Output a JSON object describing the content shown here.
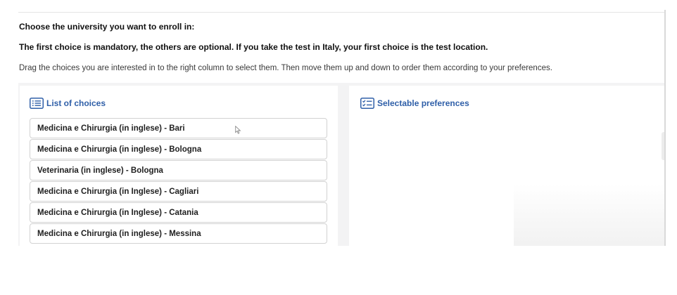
{
  "heading_1": "Choose the university you want to enroll in:",
  "heading_2": "The first choice is mandatory, the others are optional. If you take the test in Italy, your first choice is the test location.",
  "instructions": "Drag the choices you are interested in to the right column to select them. Then move them up and down to order them according to your preferences.",
  "list_panel": {
    "title": "List of choices",
    "icon": "list-icon",
    "items": [
      {
        "label": "Medicina e Chirurgia (in inglese) - Bari"
      },
      {
        "label": "Medicina e Chirurgia (in inglese) - Bologna"
      },
      {
        "label": "Veterinaria (in inglese) - Bologna"
      },
      {
        "label": "Medicina e Chirurgia (in Inglese) - Cagliari"
      },
      {
        "label": "Medicina e Chirurgia (in Inglese) - Catania"
      },
      {
        "label": "Medicina e Chirurgia (in inglese) - Messina"
      }
    ]
  },
  "preferences_panel": {
    "title": "Selectable preferences",
    "icon": "checklist-icon",
    "items": []
  },
  "colors": {
    "accent": "#2f5fa8",
    "border": "#d2d2d2",
    "panel_bg": "#f3f3f4"
  }
}
